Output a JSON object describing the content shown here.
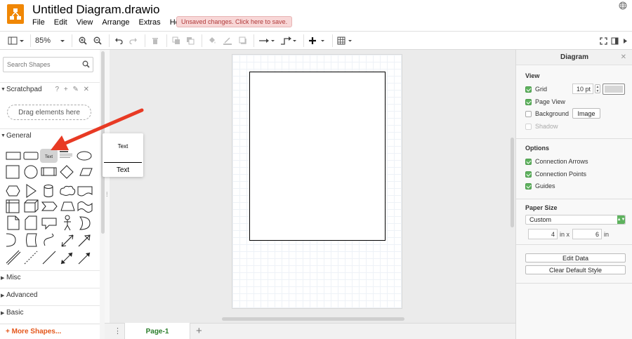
{
  "app": {
    "title": "Untitled Diagram.drawio",
    "unsaved_notice": "Unsaved changes. Click here to save."
  },
  "menu": [
    "File",
    "Edit",
    "View",
    "Arrange",
    "Extras",
    "Help"
  ],
  "toolbar": {
    "zoom": "85%"
  },
  "sidebar": {
    "search_placeholder": "Search Shapes",
    "scratchpad_title": "Scratchpad",
    "scratchpad_tools": "? + ✎ ✕",
    "drag_hint": "Drag elements here",
    "general_title": "General",
    "text_shape_label": "Text",
    "sections": [
      "Misc",
      "Advanced",
      "Basic"
    ],
    "more_shapes": "+ More Shapes..."
  },
  "popup": {
    "preview_text": "Text",
    "label": "Text"
  },
  "pages": {
    "tabs": [
      "Page-1"
    ],
    "menu_glyph": "⋮",
    "add_glyph": "+"
  },
  "format_panel": {
    "title": "Diagram",
    "close": "✕",
    "view": {
      "heading": "View",
      "grid_label": "Grid",
      "grid_checked": true,
      "grid_size": "10 pt",
      "grid_color": "#d6d6d6",
      "page_view_label": "Page View",
      "page_view_checked": true,
      "background_label": "Background",
      "background_checked": false,
      "image_button": "Image",
      "shadow_label": "Shadow",
      "shadow_checked": false
    },
    "options": {
      "heading": "Options",
      "connection_arrows": "Connection Arrows",
      "connection_points": "Connection Points",
      "guides": "Guides"
    },
    "paper": {
      "heading": "Paper Size",
      "selected": "Custom",
      "width": "4",
      "width_unit": "in x",
      "height": "6",
      "height_unit": "in"
    },
    "buttons": {
      "edit_data": "Edit Data",
      "clear_style": "Clear Default Style"
    }
  },
  "colors": {
    "accent_orange": "#f08705",
    "check_green": "#5eb25e",
    "arrow_red": "#e83a24",
    "page_tab_green": "#2a7d2a"
  }
}
